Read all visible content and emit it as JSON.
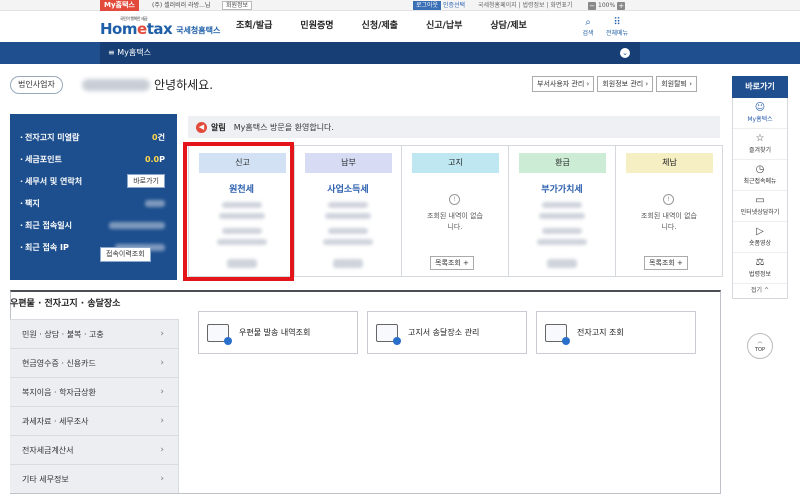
{
  "topbar": {
    "my_tab": "My홈택스",
    "company": "(주) 셀러비러 라방...님",
    "member_info": "회원정보",
    "logout": "로그아웃",
    "auth_select": "인증선택",
    "links": "국세청홈페이지 | 법령정보 | 화면표기",
    "zoom_minus": "−",
    "zoom_level": "100%",
    "zoom_plus": "+"
  },
  "header": {
    "logo_tag": "국민이 행복한 세금",
    "logo_text_a": "Hom",
    "logo_text_e": "e",
    "logo_text_b": "tax",
    "logo_sub": "국세청홈택스",
    "gnb": [
      "조회/발급",
      "민원증명",
      "신청/제출",
      "신고/납부",
      "상담/제보"
    ],
    "search_label": "검색",
    "menu_label": "전체메뉴",
    "search_icon": "search-icon",
    "menu_icon": "grid-icon"
  },
  "navbar": {
    "title": "≡ My홈택스",
    "chev": "⌄"
  },
  "greeting": {
    "badge": "법인사업자",
    "text": "안녕하세요."
  },
  "account_buttons": [
    "부서사용자 관리 ›",
    "회원정보 관리 ›",
    "회원탈퇴 ›"
  ],
  "summary": {
    "rows": [
      {
        "label": "전자고지 미열람",
        "value_num": "0",
        "value_unit": "건"
      },
      {
        "label": "세금포인트",
        "value_num": "0.0",
        "value_unit": "P"
      },
      {
        "label": "세무서 및 연락처",
        "button": "바로가기"
      },
      {
        "label": "팩지"
      },
      {
        "label": "최근 접속일시"
      },
      {
        "label": "최근 접속 IP"
      }
    ],
    "history_button": "접속이력조회"
  },
  "notice": {
    "label": "알림",
    "text": "My홈택스 방문을 환영합니다."
  },
  "cards": [
    {
      "title": "신고",
      "sub": "원천세",
      "color": "#d2e1f3"
    },
    {
      "title": "납부",
      "sub": "사업소득세",
      "color": "#d7dcf4"
    },
    {
      "title": "고지",
      "empty": "조회된 내역이 없습니다.",
      "button": "목록조회 +",
      "color": "#bfe7f1"
    },
    {
      "title": "환급",
      "sub": "부가가치세",
      "color": "#ccecd6"
    },
    {
      "title": "체납",
      "empty": "조회된 내역이 없습니다.",
      "button": "목록조회 +",
      "color": "#f6efc4"
    }
  ],
  "bottom": {
    "title": "우편물 · 전자고지 · 송달장소",
    "menu": [
      "민원 · 상담 · 불복 · 고충",
      "현금영수증 · 신용카드",
      "복지이음 · 학자금상환",
      "과세자료 · 세무조사",
      "전자세금계산서",
      "기타 세무정보"
    ],
    "tiles": [
      "우편물 발송 내역조회",
      "고지서 송달장소 관리",
      "전자고지 조회"
    ]
  },
  "quick": {
    "head": "바로가기",
    "items": [
      {
        "label": "My홈택스",
        "icon": "person-icon"
      },
      {
        "label": "즐겨찾기",
        "icon": "star-icon"
      },
      {
        "label": "최근접속메뉴",
        "icon": "history-icon"
      },
      {
        "label": "인터넷상담하기",
        "icon": "monitor-icon"
      },
      {
        "label": "숏폼영상",
        "icon": "video-icon"
      },
      {
        "label": "법령정보",
        "icon": "gavel-icon"
      }
    ],
    "fold": "접기 ^",
    "top": "TOP"
  }
}
